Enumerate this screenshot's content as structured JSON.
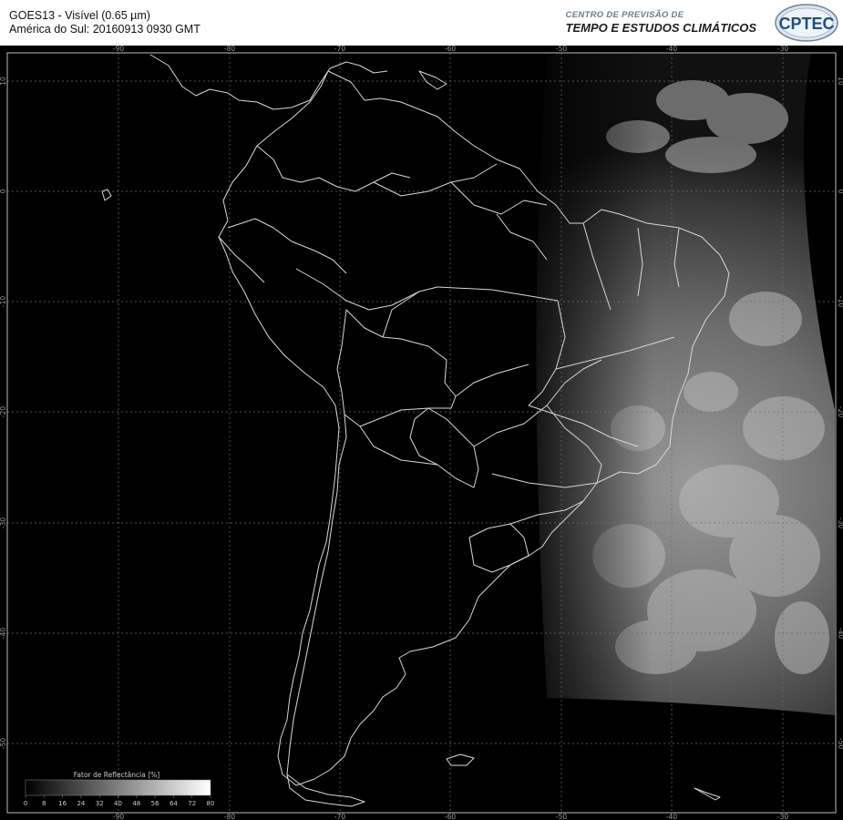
{
  "header": {
    "title_line1": "GOES13 - Visível (0.65 µm)",
    "title_line2": "América do Sul: 20160913 0930 GMT",
    "org_line1": "CENTRO DE PREVISÃO DE",
    "org_line2": "TEMPO E ESTUDOS CLIMÁTICOS",
    "logo_text": "CPTEC"
  },
  "map": {
    "lon_labels": [
      "-90",
      "-80",
      "-70",
      "-60",
      "-50",
      "-40",
      "-30"
    ],
    "lat_labels": [
      "10",
      "0",
      "-10",
      "-20",
      "-30",
      "-40",
      "-50"
    ]
  },
  "legend": {
    "title": "Fator de Reflectância [%]",
    "labels": [
      "0",
      "8",
      "16",
      "24",
      "32",
      "40",
      "48",
      "56",
      "64",
      "72",
      "80"
    ]
  },
  "colors": {
    "background": "#000000",
    "coastline": "#d8d8d8",
    "grid": "#6e6e6e"
  }
}
